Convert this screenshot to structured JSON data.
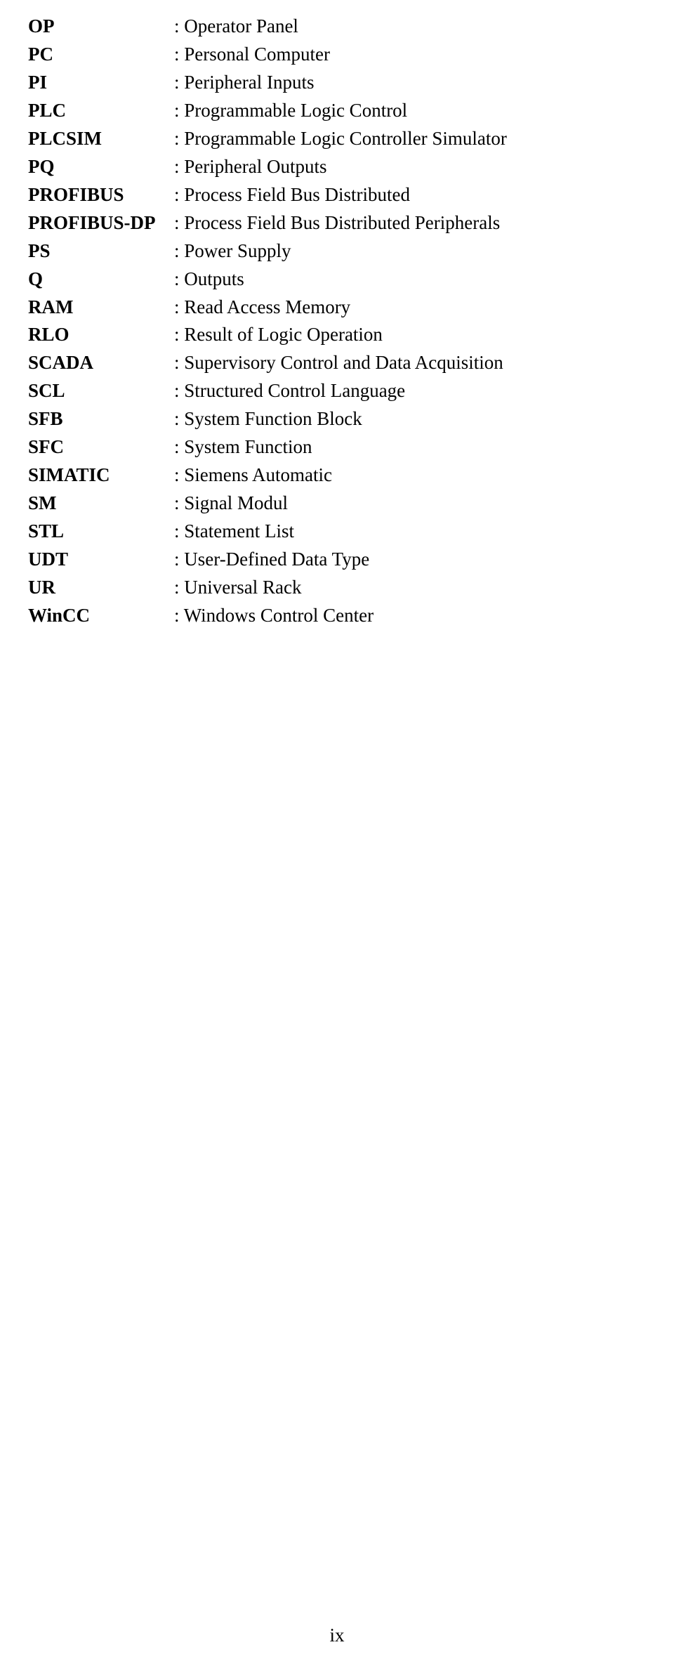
{
  "definitions": [
    {
      "abbr": "OP",
      "text": ": Operator Panel"
    },
    {
      "abbr": "PC",
      "text": ": Personal Computer"
    },
    {
      "abbr": "PI",
      "text": ": Peripheral Inputs"
    },
    {
      "abbr": "PLC",
      "text": ": Programmable Logic Control"
    },
    {
      "abbr": "PLCSIM",
      "text": ": Programmable Logic Controller Simulator"
    },
    {
      "abbr": "PQ",
      "text": ": Peripheral Outputs"
    },
    {
      "abbr": "PROFIBUS",
      "text": ": Process Field Bus Distributed"
    },
    {
      "abbr": "PROFIBUS-DP",
      "text": ": Process Field Bus Distributed Peripherals"
    },
    {
      "abbr": "PS",
      "text": ": Power Supply"
    },
    {
      "abbr": "Q",
      "text": ": Outputs"
    },
    {
      "abbr": "RAM",
      "text": ": Read Access Memory"
    },
    {
      "abbr": "RLO",
      "text": ": Result of Logic Operation"
    },
    {
      "abbr": "SCADA",
      "text": ": Supervisory Control and Data Acquisition"
    },
    {
      "abbr": "SCL",
      "text": ": Structured Control Language"
    },
    {
      "abbr": "SFB",
      "text": ": System Function Block"
    },
    {
      "abbr": "SFC",
      "text": ": System Function"
    },
    {
      "abbr": "SIMATIC",
      "text": ": Siemens Automatic"
    },
    {
      "abbr": "SM",
      "text": ": Signal Modul"
    },
    {
      "abbr": "STL",
      "text": ": Statement List"
    },
    {
      "abbr": "UDT",
      "text": ": User-Defined Data Type"
    },
    {
      "abbr": "UR",
      "text": ": Universal Rack"
    },
    {
      "abbr": "WinCC",
      "text": ": Windows Control Center"
    }
  ],
  "page_number": "ix"
}
